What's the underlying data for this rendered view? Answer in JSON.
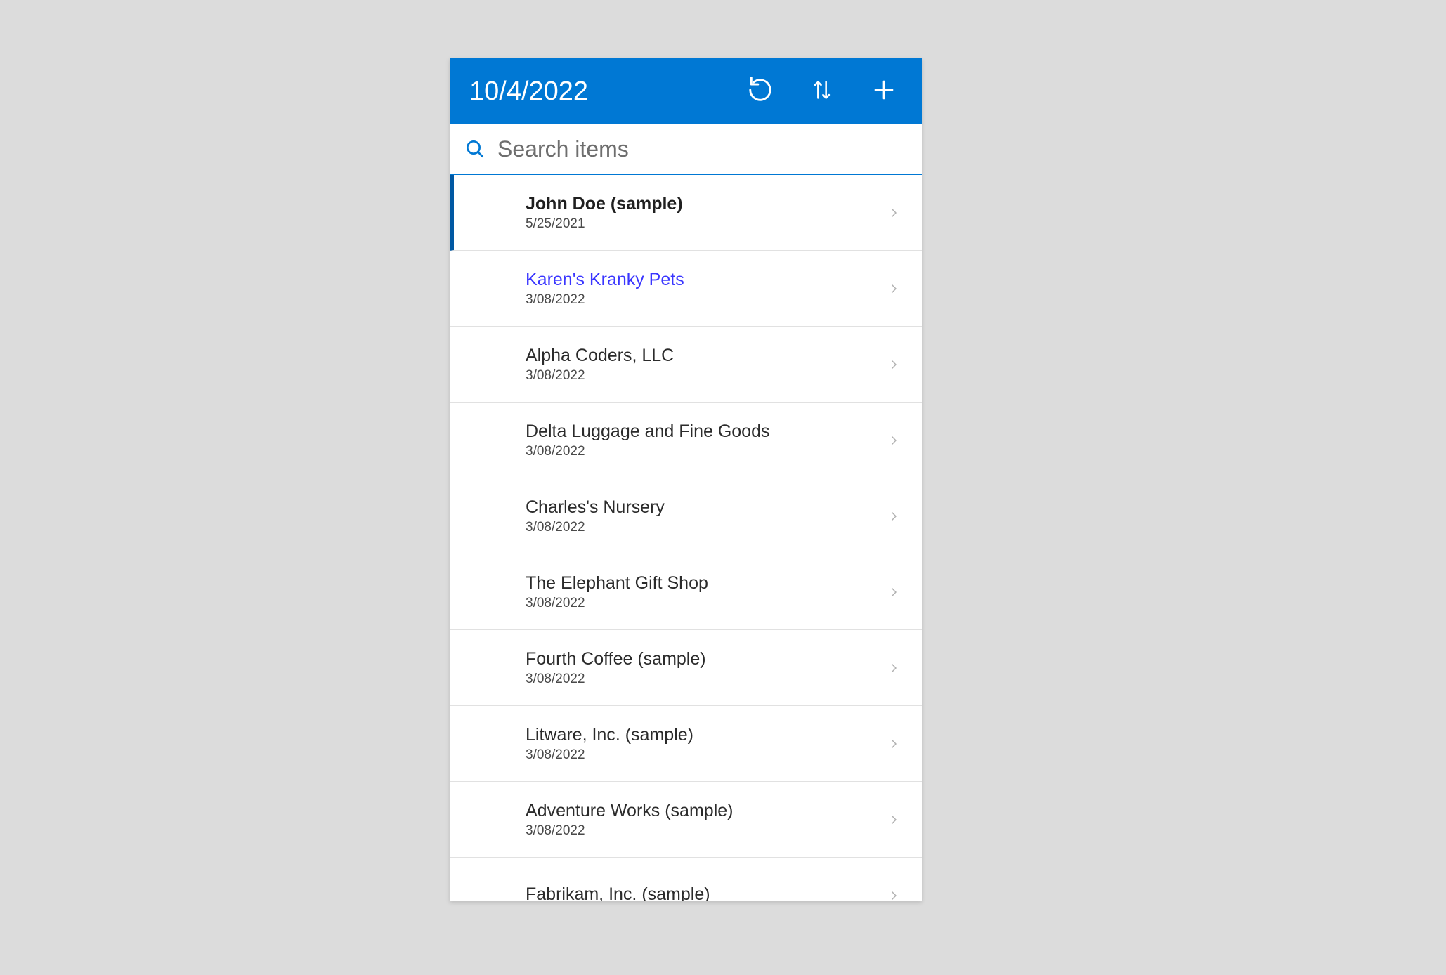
{
  "header": {
    "title": "10/4/2022"
  },
  "search": {
    "placeholder": "Search items"
  },
  "items": [
    {
      "title": "John Doe (sample)",
      "date": "5/25/2021",
      "selected": true,
      "link": false
    },
    {
      "title": "Karen's Kranky Pets",
      "date": "3/08/2022",
      "selected": false,
      "link": true
    },
    {
      "title": "Alpha Coders, LLC",
      "date": "3/08/2022",
      "selected": false,
      "link": false
    },
    {
      "title": "Delta Luggage and Fine Goods",
      "date": "3/08/2022",
      "selected": false,
      "link": false
    },
    {
      "title": "Charles's Nursery",
      "date": "3/08/2022",
      "selected": false,
      "link": false
    },
    {
      "title": "The Elephant Gift Shop",
      "date": "3/08/2022",
      "selected": false,
      "link": false
    },
    {
      "title": "Fourth Coffee (sample)",
      "date": "3/08/2022",
      "selected": false,
      "link": false
    },
    {
      "title": "Litware, Inc. (sample)",
      "date": "3/08/2022",
      "selected": false,
      "link": false
    },
    {
      "title": "Adventure Works (sample)",
      "date": "3/08/2022",
      "selected": false,
      "link": false
    },
    {
      "title": "Fabrikam, Inc. (sample)",
      "date": "",
      "selected": false,
      "link": false
    }
  ]
}
